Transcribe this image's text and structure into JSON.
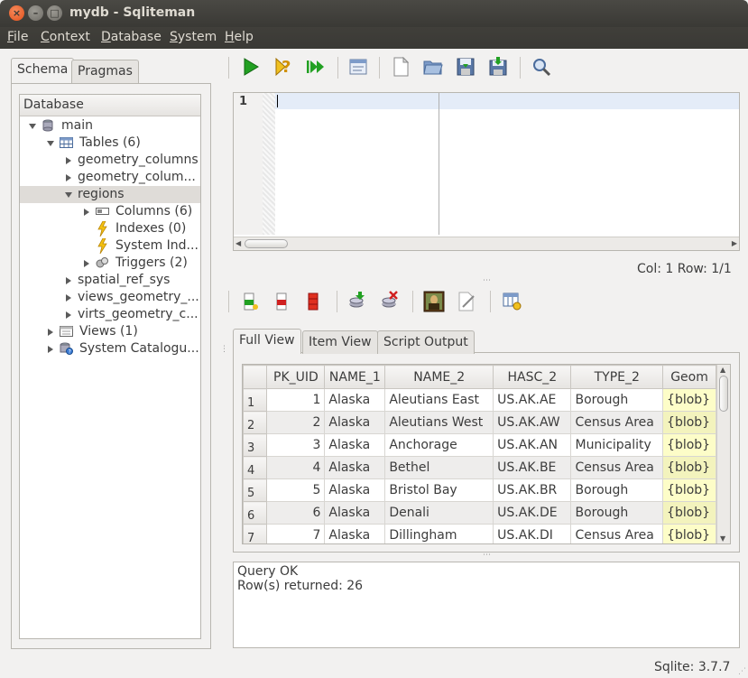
{
  "window": {
    "title": "mydb - Sqliteman"
  },
  "menu": [
    {
      "label": "File",
      "key": "F",
      "rest": "ile"
    },
    {
      "label": "Context",
      "key": "C",
      "rest": "ontext"
    },
    {
      "label": "Database",
      "key": "D",
      "rest": "atabase"
    },
    {
      "label": "System",
      "key": "S",
      "rest": "ystem"
    },
    {
      "label": "Help",
      "key": "H",
      "rest": "elp"
    }
  ],
  "left_tabs": {
    "schema": "Schema",
    "pragmas": "Pragmas"
  },
  "tree": {
    "header": "Database",
    "main": "main",
    "tables": "Tables (6)",
    "geometry_columns": "geometry_columns",
    "geometry_colum2": "geometry_colum...",
    "regions": "regions",
    "columns": "Columns (6)",
    "indexes": "Indexes (0)",
    "system_ind": "System Ind...",
    "triggers": "Triggers (2)",
    "spatial_ref_sys": "spatial_ref_sys",
    "views_geometry": "views_geometry_...",
    "virts_geometry": "virts_geometry_c...",
    "views": "Views (1)",
    "system_catalogue": "System Catalogu..."
  },
  "editor": {
    "line_number": "1",
    "status": "Col: 1 Row: 1/1"
  },
  "result_tabs": {
    "full": "Full View",
    "item": "Item View",
    "script": "Script Output"
  },
  "grid": {
    "headers": [
      "PK_UID",
      "NAME_1",
      "NAME_2",
      "HASC_2",
      "TYPE_2",
      "Geom"
    ],
    "rows": [
      {
        "n": "1",
        "pk": "1",
        "name1": "Alaska",
        "name2": "Aleutians East",
        "hasc": "US.AK.AE",
        "type": "Borough",
        "geom": "{blob}"
      },
      {
        "n": "2",
        "pk": "2",
        "name1": "Alaska",
        "name2": "Aleutians West",
        "hasc": "US.AK.AW",
        "type": "Census Area",
        "geom": "{blob}"
      },
      {
        "n": "3",
        "pk": "3",
        "name1": "Alaska",
        "name2": "Anchorage",
        "hasc": "US.AK.AN",
        "type": "Municipality",
        "geom": "{blob}"
      },
      {
        "n": "4",
        "pk": "4",
        "name1": "Alaska",
        "name2": "Bethel",
        "hasc": "US.AK.BE",
        "type": "Census Area",
        "geom": "{blob}"
      },
      {
        "n": "5",
        "pk": "5",
        "name1": "Alaska",
        "name2": "Bristol Bay",
        "hasc": "US.AK.BR",
        "type": "Borough",
        "geom": "{blob}"
      },
      {
        "n": "6",
        "pk": "6",
        "name1": "Alaska",
        "name2": "Denali",
        "hasc": "US.AK.DE",
        "type": "Borough",
        "geom": "{blob}"
      },
      {
        "n": "7",
        "pk": "7",
        "name1": "Alaska",
        "name2": "Dillingham",
        "hasc": "US.AK.DI",
        "type": "Census Area",
        "geom": "{blob}"
      }
    ]
  },
  "output": {
    "line1": "Query OK",
    "line2": "Row(s) returned: 26"
  },
  "statusbar": {
    "version": "Sqlite: 3.7.7"
  }
}
